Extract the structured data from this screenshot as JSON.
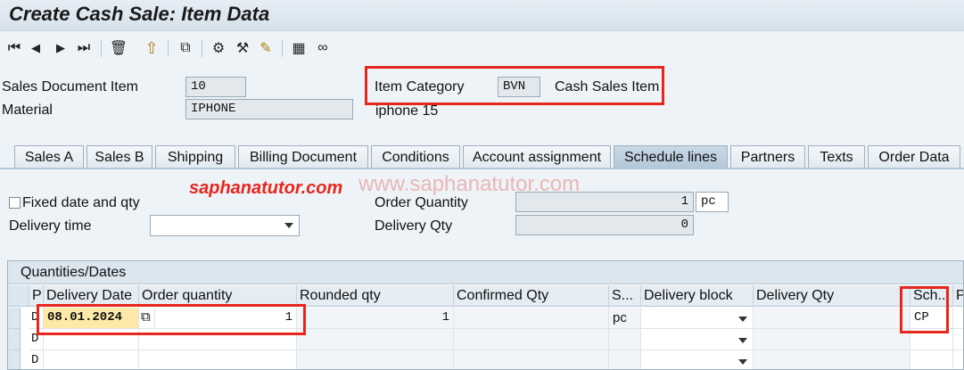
{
  "window": {
    "title": "Create Cash Sale: Item Data"
  },
  "toolbar": {
    "icons": [
      "first-icon",
      "previous-icon",
      "next-icon",
      "last-icon",
      "delete-icon",
      "up-icon",
      "copy-icon",
      "configure-icon",
      "tools-icon",
      "edit-icon",
      "calculator-icon",
      "glasses-icon"
    ],
    "glyphs": {
      "first": "⏮",
      "prev": "◀",
      "next": "▶",
      "last": "⏭",
      "delete": "🗑",
      "up": "⇧",
      "copy": "⧉",
      "config": "⚙",
      "tools": "⚒",
      "edit": "✎",
      "calc": "▦",
      "glasses": "∞"
    }
  },
  "header": {
    "sales_doc_item_label": "Sales Document Item",
    "sales_doc_item_value": "10",
    "material_label": "Material",
    "material_value": "IPHONE",
    "material_desc": "iphone 15",
    "item_category_label": "Item Category",
    "item_category_value": "BVN",
    "item_category_desc": "Cash Sales Item"
  },
  "tabs": [
    "Sales A",
    "Sales B",
    "Shipping",
    "Billing Document",
    "Conditions",
    "Account assignment",
    "Schedule lines",
    "Partners",
    "Texts",
    "Order Data"
  ],
  "active_tab": "Schedule lines",
  "watermark": {
    "brand": "saphanatutor.com",
    "url": "www.saphanatutor.com"
  },
  "schedule": {
    "fixed_date_label": "Fixed date and qty",
    "delivery_time_label": "Delivery time",
    "delivery_time_value": "",
    "order_qty_label": "Order Quantity",
    "order_qty_value": "1",
    "order_qty_unit": "pc",
    "delivery_qty_label": "Delivery Qty",
    "delivery_qty_value": "0"
  },
  "grid": {
    "title": "Quantities/Dates",
    "columns": [
      "P",
      "Delivery Date",
      "Order quantity",
      "Rounded qty",
      "Confirmed Qty",
      "S...",
      "Delivery block",
      "Delivery Qty",
      "Sch...",
      "Pr"
    ],
    "rows": [
      {
        "p": "D",
        "date": "08.01.2024",
        "order_qty": "1",
        "rounded": "1",
        "confirmed": "",
        "su": "pc",
        "block": "",
        "dqty": "",
        "sch": "CP"
      },
      {
        "p": "D",
        "date": "",
        "order_qty": "",
        "rounded": "",
        "confirmed": "",
        "su": "",
        "block": "",
        "dqty": "",
        "sch": ""
      },
      {
        "p": "D",
        "date": "",
        "order_qty": "",
        "rounded": "",
        "confirmed": "",
        "su": "",
        "block": "",
        "dqty": "",
        "sch": ""
      }
    ]
  },
  "colors": {
    "highlight": "#e8261d",
    "date_bg": "#fde9a8"
  }
}
